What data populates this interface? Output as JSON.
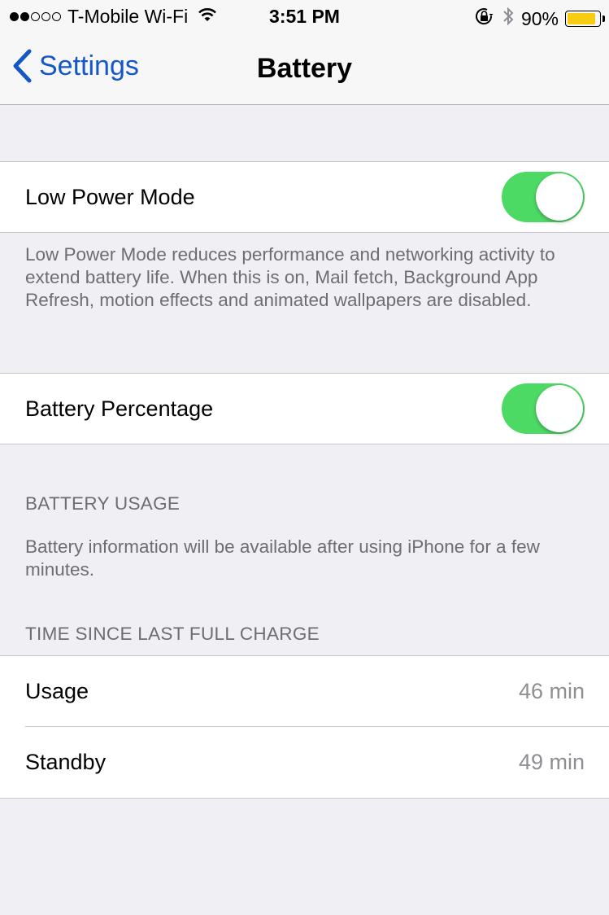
{
  "status_bar": {
    "signal_filled": 2,
    "signal_total": 5,
    "carrier": "T-Mobile Wi-Fi",
    "time": "3:51 PM",
    "battery_percent_text": "90%",
    "battery_level": 0.9,
    "icons": [
      "wifi-icon",
      "orientation-lock-icon",
      "bluetooth-icon",
      "battery-icon"
    ]
  },
  "nav": {
    "back_label": "Settings",
    "title": "Battery"
  },
  "low_power": {
    "label": "Low Power Mode",
    "enabled": true,
    "footer": "Low Power Mode reduces performance and networking activity to extend battery life.  When this is on, Mail fetch, Background App Refresh, motion effects and animated wallpapers are disabled."
  },
  "battery_percentage": {
    "label": "Battery Percentage",
    "enabled": true
  },
  "battery_usage": {
    "header": "BATTERY USAGE",
    "footer": "Battery information will be available after using iPhone for a few minutes."
  },
  "time_since_charge": {
    "header": "TIME SINCE LAST FULL CHARGE",
    "rows": [
      {
        "label": "Usage",
        "value": "46 min"
      },
      {
        "label": "Standby",
        "value": "49 min"
      }
    ]
  },
  "colors": {
    "accent": "#1657c6",
    "toggle_on": "#4cd964",
    "battery_fill": "#f8cc13",
    "background": "#efeff4"
  }
}
